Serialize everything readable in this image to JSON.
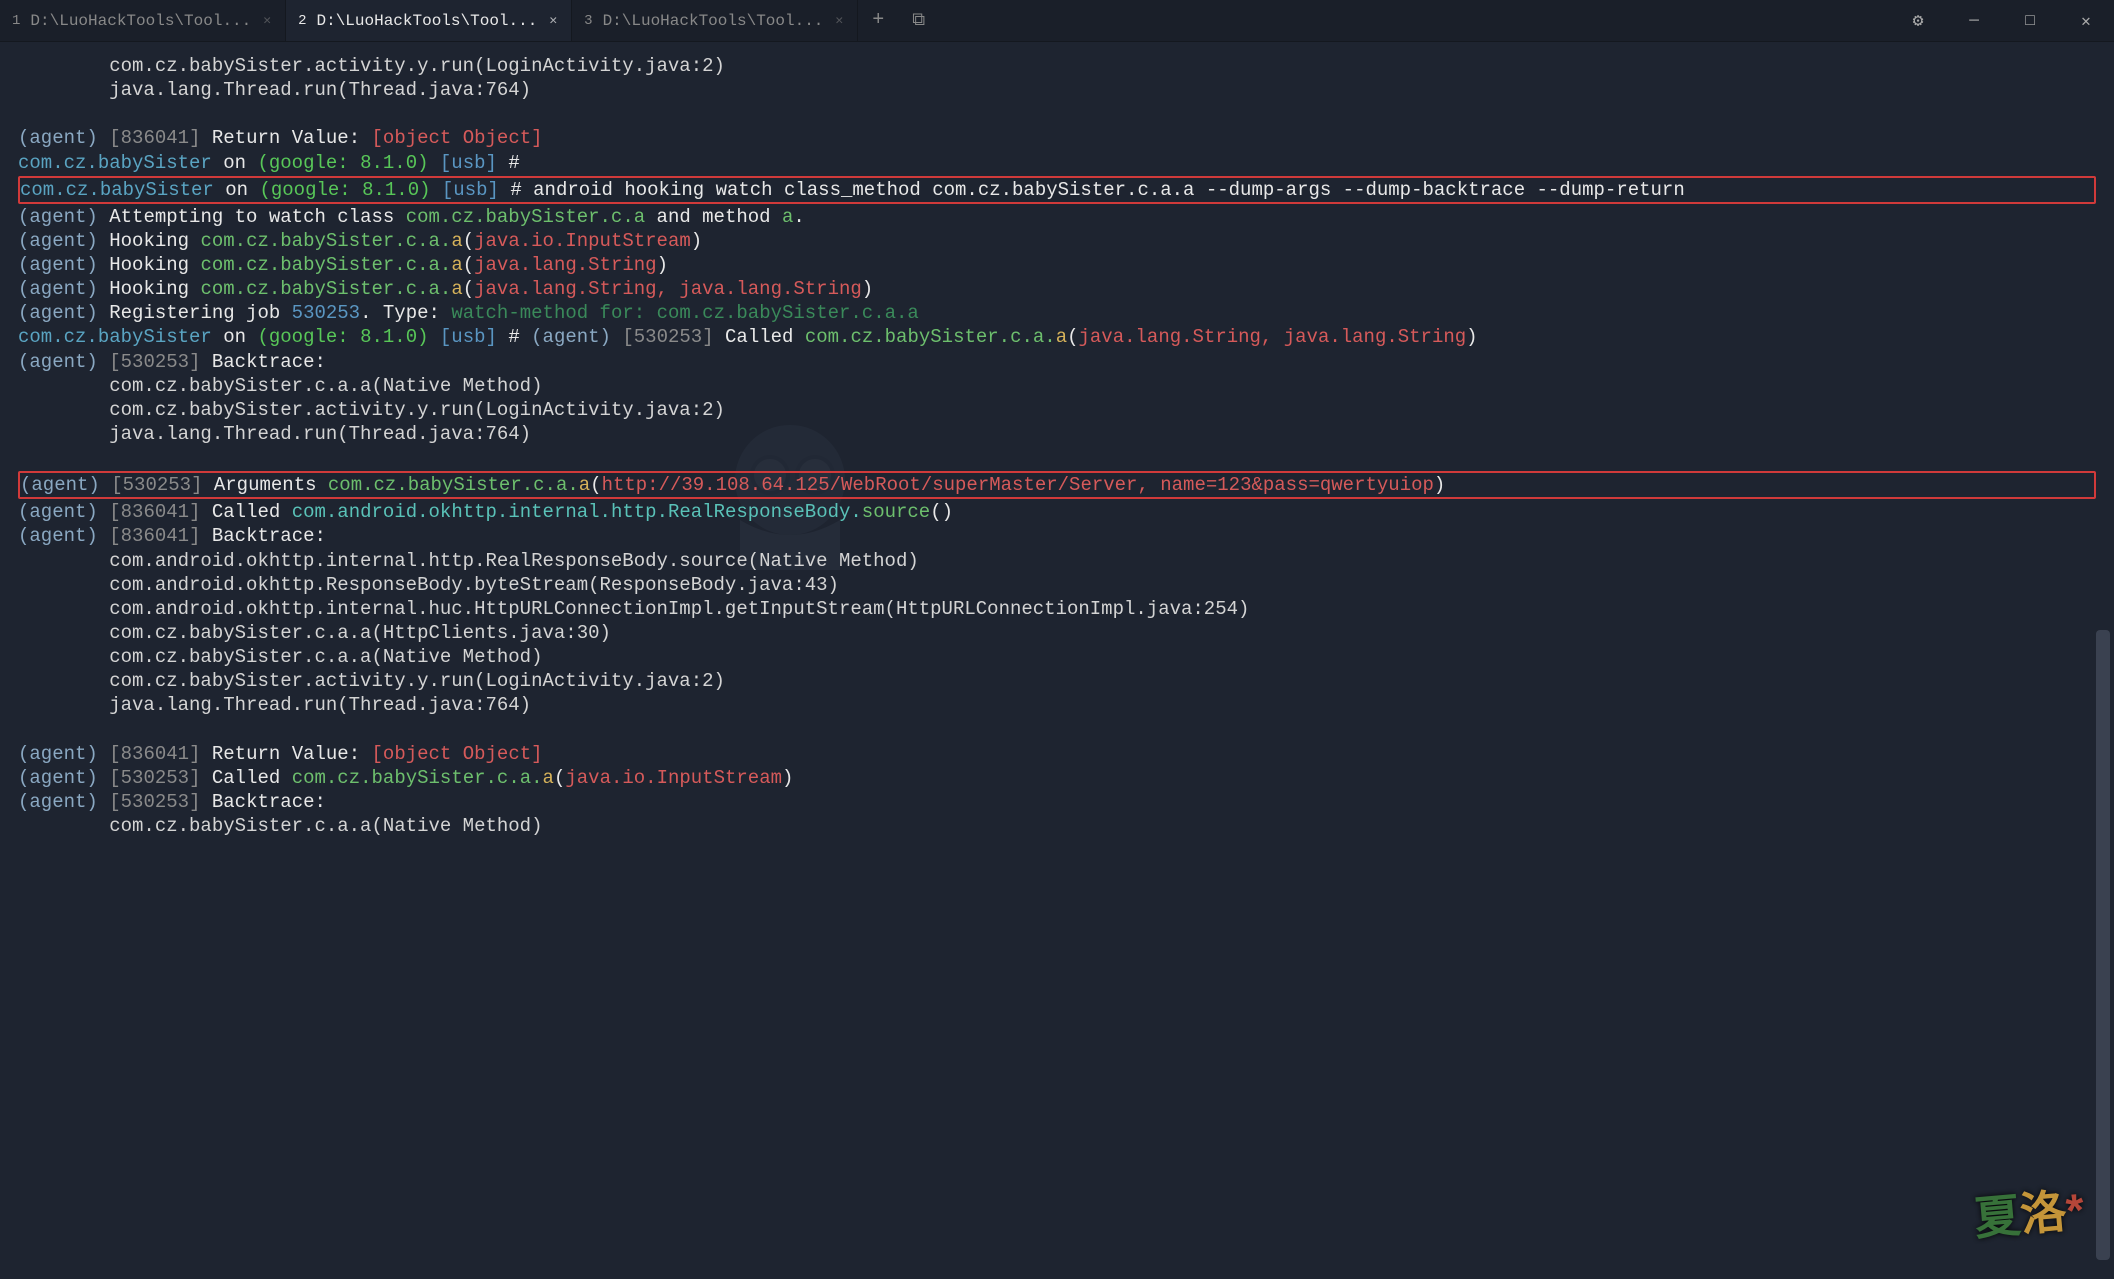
{
  "tabs": [
    {
      "num": "1",
      "name": "D:\\LuoHackTools\\Tool..."
    },
    {
      "num": "2",
      "name": "D:\\LuoHackTools\\Tool...",
      "active": true
    },
    {
      "num": "3",
      "name": "D:\\LuoHackTools\\Tool..."
    }
  ],
  "ui": {
    "newtab": "+",
    "cascade": "⧉",
    "gear": "⚙",
    "min": "─",
    "max": "□",
    "close": "✕"
  },
  "col": {
    "agent": "(agent)",
    "return_label": "Return Value:",
    "object": "[object Object]",
    "pkg": "com.cz.babySister",
    "on": "on",
    "google": "(google: 8.1.0)",
    "usb": "[usb]",
    "hash": "#",
    "job": "836041",
    "job2": "530253",
    "backtrace": "Backtrace:",
    "arguments": "Arguments",
    "called": "Called"
  },
  "cmd": "android hooking watch class_method com.cz.babySister.c.a.a --dump-args --dump-backtrace --dump-return",
  "attempt": {
    "pre": "Attempting to watch class",
    "cls": "com.cz.babySister.c.a",
    "mid": "and method",
    "m": "a"
  },
  "hook": {
    "label": "Hooking",
    "cls": "com.cz.babySister.c.a.",
    "m": "a",
    "args1": "java.io.InputStream",
    "args2": "java.lang.String",
    "args3": "java.lang.String, java.lang.String"
  },
  "reg": {
    "pre": "Registering job",
    "dot": ". Type:",
    "watch": "watch-method for:",
    "path": "com.cz.babySister.c.a.a"
  },
  "argline": {
    "path": "com.cz.babySister.c.a.",
    "m": "a",
    "http": "http://39.108.64.125/WebRoot/superMaster/Server, name=123&pass=qwertyuiop"
  },
  "okhttp": {
    "path": "com.android.okhttp.internal.http.RealResponseBody.",
    "m": "source",
    "paren": "()"
  },
  "bt1": [
    "com.cz.babySister.activity.y.run(LoginActivity.java:2)",
    "java.lang.Thread.run(Thread.java:764)"
  ],
  "bt2": [
    "com.cz.babySister.c.a.a(Native Method)",
    "com.cz.babySister.activity.y.run(LoginActivity.java:2)",
    "java.lang.Thread.run(Thread.java:764)"
  ],
  "bt3": [
    "com.android.okhttp.internal.http.RealResponseBody.source(Native Method)",
    "com.android.okhttp.ResponseBody.byteStream(ResponseBody.java:43)",
    "com.android.okhttp.internal.huc.HttpURLConnectionImpl.getInputStream(HttpURLConnectionImpl.java:254)",
    "com.cz.babySister.c.a.a(HttpClients.java:30)",
    "com.cz.babySister.c.a.a(Native Method)",
    "com.cz.babySister.activity.y.run(LoginActivity.java:2)",
    "java.lang.Thread.run(Thread.java:764)"
  ],
  "bt4": [
    "com.cz.babySister.c.a.a(Native Method)"
  ],
  "inputstream": "java.io.InputStream"
}
